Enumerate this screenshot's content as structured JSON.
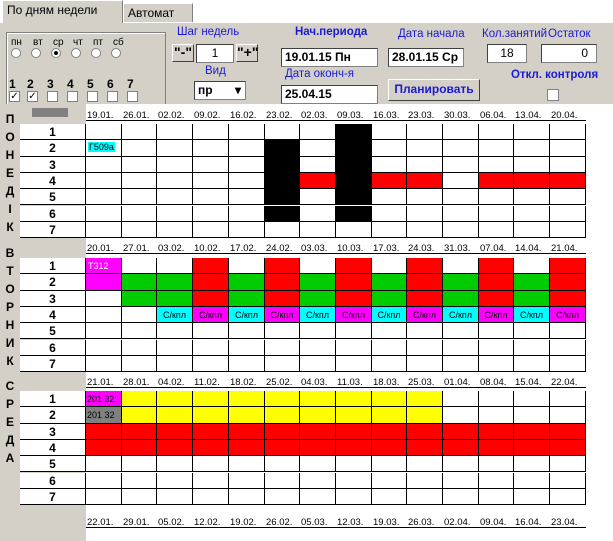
{
  "tabs": [
    "По дням недели",
    "Автомат"
  ],
  "days_short": [
    "пн",
    "вт",
    "ср",
    "чт",
    "пт",
    "сб"
  ],
  "day_numbers": [
    "1",
    "2",
    "3",
    "4",
    "5",
    "6",
    "7"
  ],
  "day_checks": [
    true,
    true,
    false,
    false,
    false,
    false,
    false
  ],
  "labels": {
    "step": "Шаг недель",
    "view": "Вид",
    "period_start": "Нач.периода",
    "period_end": "Дата оконч-я",
    "start_date": "Дата начала",
    "lessons_count": "Кол.занятий",
    "remainder": "Остаток",
    "disable_control": "Откл. контроля"
  },
  "values": {
    "step": "1",
    "view": "пр",
    "period_start": "19.01.15 Пн",
    "period_end": "25.04.15",
    "start_date": "28.01.15 Ср",
    "lessons_count": "18",
    "remainder": "0"
  },
  "buttons": {
    "minus": "\"-\"",
    "plus": "\"+\"",
    "plan": "Планировать"
  },
  "day_letters": [
    [
      "П",
      "О",
      "Н",
      "Е",
      "Д",
      "І",
      "К"
    ],
    [
      "В",
      "Т",
      "О",
      "Р",
      "Н",
      "И",
      "К"
    ],
    [
      "С",
      "Р",
      "Е",
      "Д",
      "А"
    ]
  ],
  "dates": [
    [
      "19.01.",
      "26.01.",
      "02.02.",
      "09.02.",
      "16.02.",
      "23.02.",
      "02.03.",
      "09.03.",
      "16.03.",
      "23.03.",
      "30.03.",
      "06.04.",
      "13.04.",
      "20.04."
    ],
    [
      "20.01.",
      "27.01.",
      "03.02.",
      "10.02.",
      "17.02.",
      "24.02.",
      "03.03.",
      "10.03.",
      "17.03.",
      "24.03.",
      "31.03.",
      "07.04.",
      "14.04.",
      "21.04."
    ],
    [
      "21.01.",
      "28.01.",
      "04.02.",
      "11.02.",
      "18.02.",
      "25.02.",
      "04.03.",
      "11.03.",
      "18.03.",
      "25.03.",
      "01.04.",
      "08.04.",
      "15.04.",
      "22.04."
    ],
    [
      "22.01.",
      "29.01.",
      "05.02.",
      "12.02.",
      "19.02.",
      "26.02.",
      "05.03.",
      "12.03.",
      "19.03.",
      "26.03.",
      "02.04.",
      "09.04.",
      "16.04.",
      "23.04."
    ]
  ],
  "tags": {
    "mon": "Г509а",
    "tue": "Т312",
    "wed1": "201 32",
    "wed2": "201 32",
    "skpl": "С/кпл"
  },
  "colors": {
    "black": "#000000",
    "red": "#ff0000",
    "green": "#00cc00",
    "yellow": "#ffff00",
    "magenta": "#ff00ff",
    "cyan": "#00ffff",
    "gray": "#808080",
    "label_blue": "#1a1ad0"
  }
}
